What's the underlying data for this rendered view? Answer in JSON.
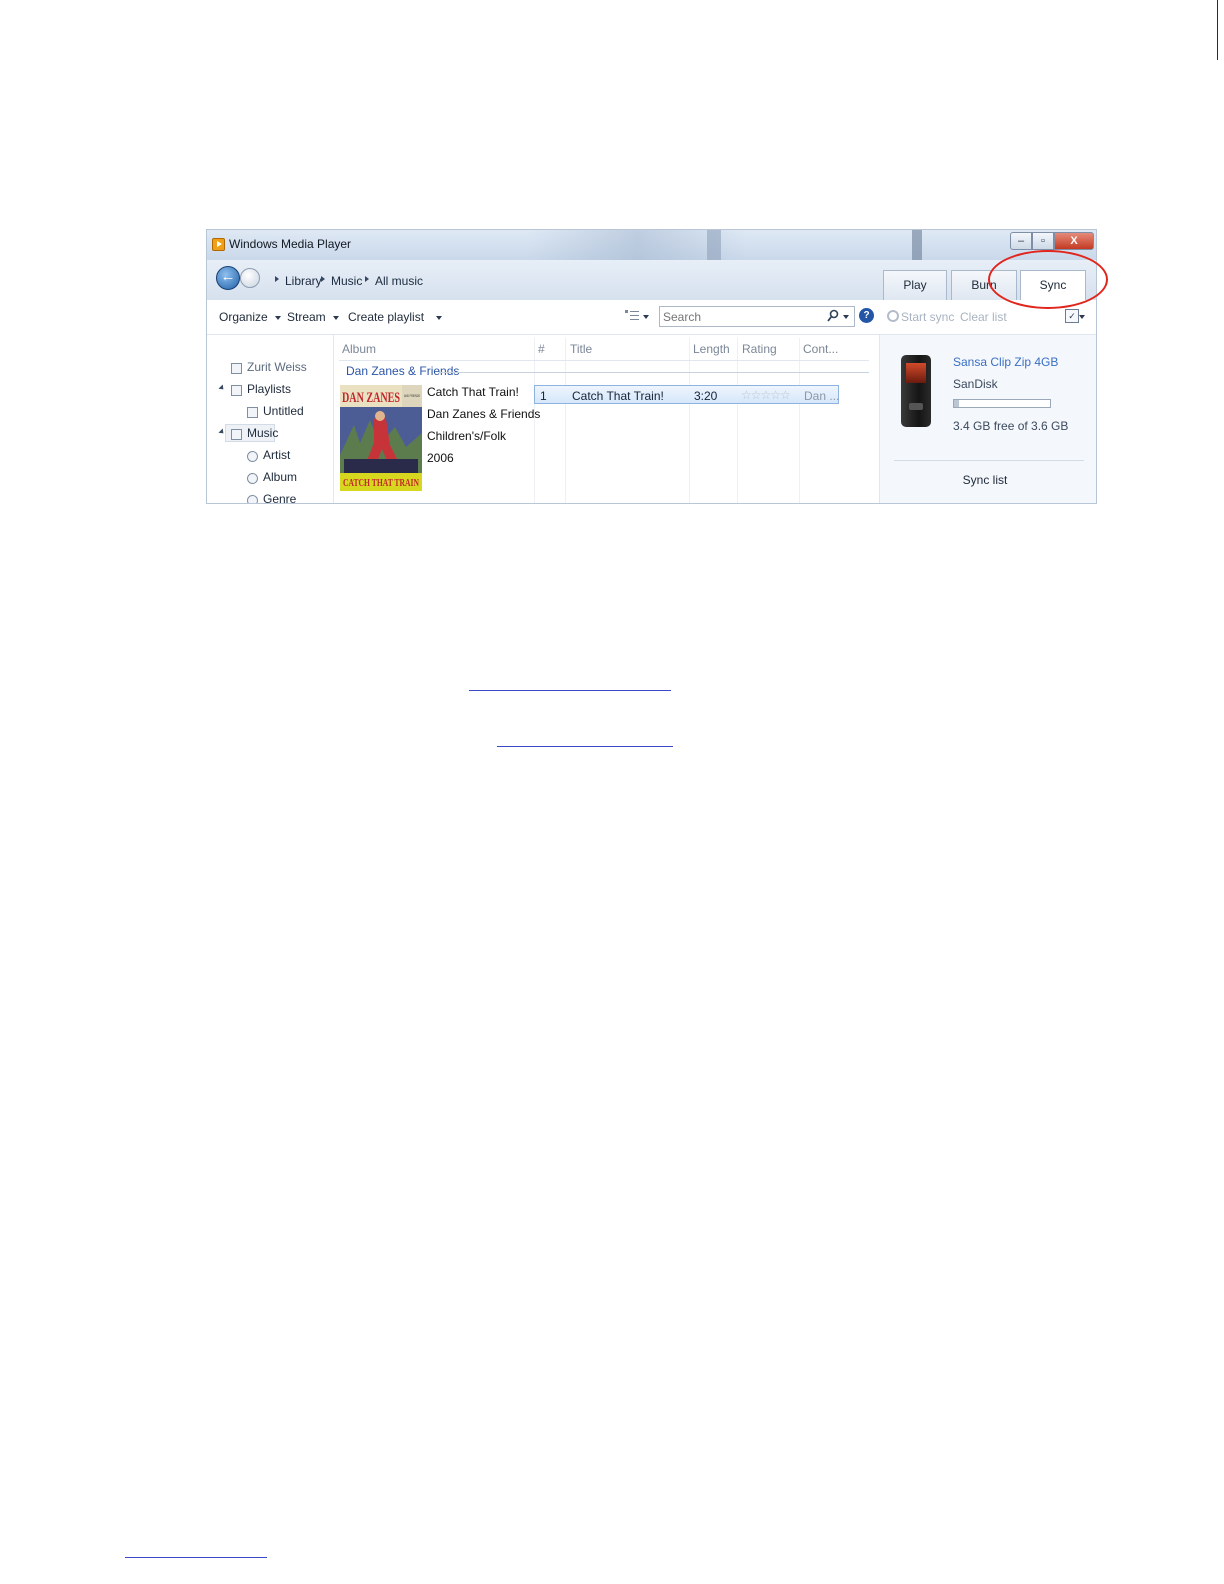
{
  "window": {
    "title": "Windows Media Player",
    "close_glyph": "X"
  },
  "breadcrumb": [
    "Library",
    "Music",
    "All music"
  ],
  "tabs": {
    "play": "Play",
    "burn": "Burn",
    "sync": "Sync"
  },
  "toolbar": {
    "organize": "Organize",
    "stream": "Stream",
    "create_playlist": "Create playlist",
    "search_placeholder": "Search",
    "help": "?",
    "start_sync": "Start sync",
    "clear_list": "Clear list",
    "options": "✓"
  },
  "nav": {
    "user": "Zurit Weiss",
    "playlists": "Playlists",
    "untitled": "Untitled",
    "music": "Music",
    "artist": "Artist",
    "album": "Album",
    "genre": "Genre"
  },
  "columns": {
    "album": "Album",
    "number": "#",
    "title": "Title",
    "length": "Length",
    "rating": "Rating",
    "contributing": "Cont..."
  },
  "library": {
    "group_title": "Dan Zanes & Friends",
    "album_title": "Catch That Train!",
    "album_artist": "Dan Zanes & Friends",
    "album_genre": "Children's/Folk",
    "album_year": "2006",
    "cover_top": "DAN ZANES",
    "cover_corner": "AND FRIENDS",
    "cover_bottom": "CATCH THAT TRAIN",
    "track": {
      "number": "1",
      "title": "Catch That Train!",
      "length": "3:20",
      "rating_stars": "☆☆☆☆☆",
      "contributing": "Dan ..."
    }
  },
  "device": {
    "name": "Sansa Clip Zip 4GB",
    "brand": "SanDisk",
    "free_text": "3.4 GB free of 3.6 GB",
    "used_fraction": 0.056,
    "sync_list_label": "Sync list"
  },
  "colors": {
    "highlight_ellipse": "#e0251c",
    "link_blue": "#3a6fc4"
  }
}
